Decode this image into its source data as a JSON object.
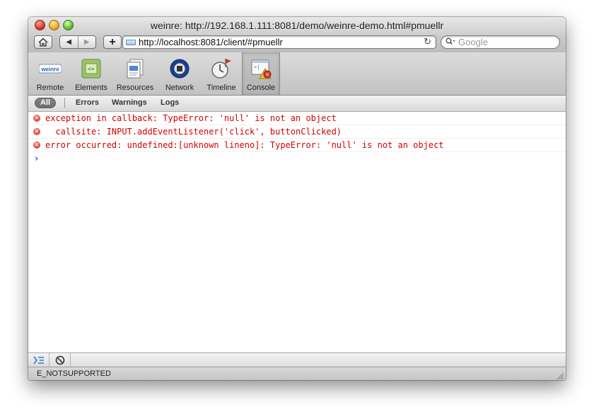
{
  "window": {
    "title": "weinre: http://192.168.1.111:8081/demo/weinre-demo.html#pmuellr"
  },
  "browser_toolbar": {
    "url": "http://localhost:8081/client/#pmuellr",
    "search_placeholder": "Google",
    "add_label": "+",
    "reload_glyph": "↻",
    "back_glyph": "◀",
    "forward_glyph": "▶"
  },
  "panels": [
    {
      "label": "Remote",
      "icon": "weinre-logo-icon",
      "active": false
    },
    {
      "label": "Elements",
      "icon": "elements-icon",
      "active": false
    },
    {
      "label": "Resources",
      "icon": "resources-icon",
      "active": false
    },
    {
      "label": "Network",
      "icon": "network-icon",
      "active": false
    },
    {
      "label": "Timeline",
      "icon": "timeline-icon",
      "active": false
    },
    {
      "label": "Console",
      "icon": "console-icon",
      "active": true
    }
  ],
  "weinre_logo_text": "weinre",
  "filters": {
    "all": "All",
    "errors": "Errors",
    "warnings": "Warnings",
    "logs": "Logs"
  },
  "console": {
    "messages": [
      {
        "level": "error",
        "text": "exception in callback: TypeError: 'null' is not an object"
      },
      {
        "level": "error",
        "text": "  callsite: INPUT.addEventListener('click', buttonClicked)"
      },
      {
        "level": "error",
        "text": "error occurred: undefined:[unknown lineno]: TypeError: 'null' is not an object"
      }
    ],
    "prompt": "›"
  },
  "status": {
    "text": "E_NOTSUPPORTED"
  },
  "colors": {
    "error_text": "#d40000",
    "prompt": "#2a6fd6"
  }
}
